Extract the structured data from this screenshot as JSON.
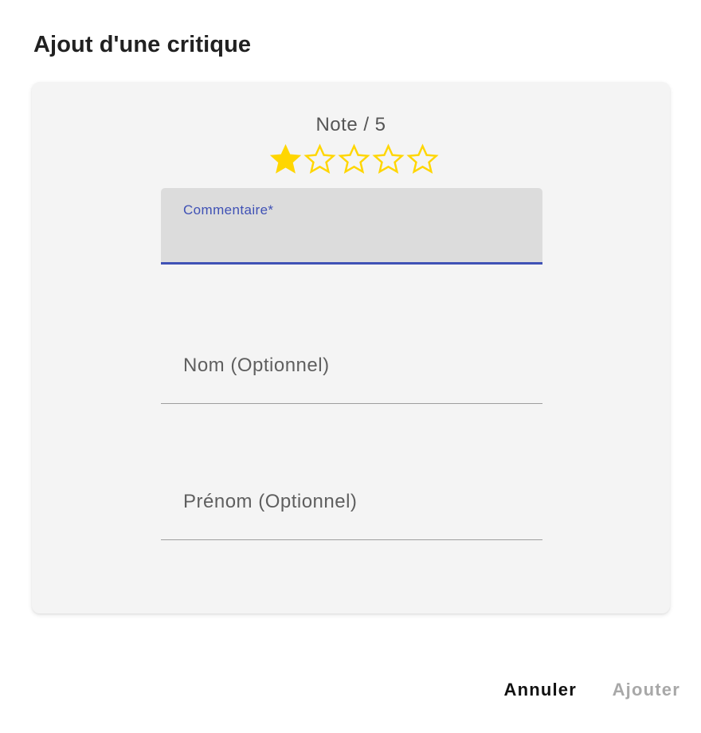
{
  "dialog": {
    "title": "Ajout d'une critique"
  },
  "rating": {
    "label": "Note / 5",
    "max": 5,
    "value": 1,
    "filled_color": "#FFD600",
    "outline_color": "#FFD600"
  },
  "fields": {
    "comment": {
      "label": "Commentaire*",
      "value": "",
      "accent_color": "#3F51B5"
    },
    "nom": {
      "label": "Nom (Optionnel)",
      "value": ""
    },
    "prenom": {
      "label": "Prénom (Optionnel)",
      "value": ""
    }
  },
  "actions": {
    "cancel_label": "Annuler",
    "add_label": "Ajouter",
    "add_disabled": true
  },
  "icons": [
    "star-filled-icon",
    "star-outline-icon"
  ]
}
